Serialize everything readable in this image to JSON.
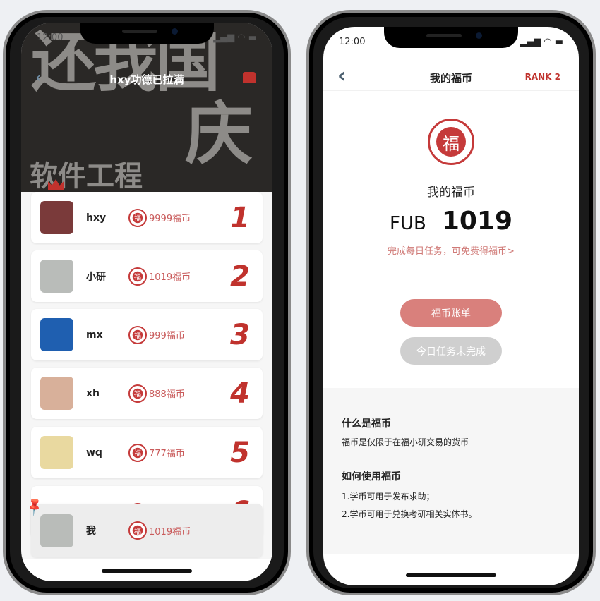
{
  "left": {
    "status_time": "12:00",
    "hero_text": [
      "还我国",
      "庆",
      "软件工程"
    ],
    "title": "hxy功德已拉满",
    "ranking": [
      {
        "name": "hxy",
        "coins": "9999福币",
        "rank": "1",
        "avatar_color": "#7a3a3a"
      },
      {
        "name": "小研",
        "coins": "1019福币",
        "rank": "2",
        "avatar_color": "#b9bcb9"
      },
      {
        "name": "mx",
        "coins": "999福币",
        "rank": "3",
        "avatar_color": "#1f5fb0"
      },
      {
        "name": "xh",
        "coins": "888福币",
        "rank": "4",
        "avatar_color": "#d8b09a"
      },
      {
        "name": "wq",
        "coins": "777福币",
        "rank": "5",
        "avatar_color": "#e9d9a0"
      },
      {
        "name": "",
        "coins": "",
        "rank": "6",
        "avatar_color": "#ffffff"
      }
    ],
    "me": {
      "name": "我",
      "coins": "1019福币"
    },
    "coin_glyph": "福"
  },
  "right": {
    "status_time": "12:00",
    "title": "我的福币",
    "rank_label": "RANK 2",
    "seal_glyph": "福",
    "label": "我的福币",
    "currency": "FUB",
    "balance": "1019",
    "task_link": "完成每日任务，可免费得福币>",
    "bill_button": "福币账单",
    "task_button": "今日任务未完成",
    "faq": [
      {
        "q": "什么是福币",
        "a": [
          "福币是仅限于在福小研交易的货币"
        ]
      },
      {
        "q": "如何使用福币",
        "a": [
          "1.学币可用于发布求助；",
          "2.学币可用于兑换考研相关实体书。"
        ]
      }
    ],
    "accent": "#c0322d",
    "button_color": "#d9807c",
    "disabled_color": "#cfcfcf"
  }
}
